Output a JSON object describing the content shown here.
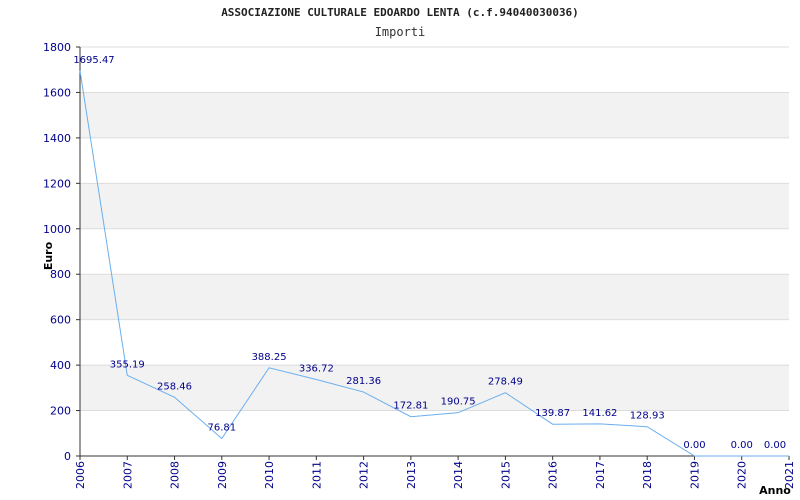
{
  "chart_data": {
    "type": "line",
    "title": "ASSOCIAZIONE CULTURALE EDOARDO LENTA (c.f.94040030036)",
    "subtitle": "Importi",
    "xlabel": "Anno",
    "ylabel": "Euro",
    "ylim": [
      0,
      1800
    ],
    "yticks": [
      "0",
      "200",
      "400",
      "600",
      "800",
      "1000",
      "1200",
      "1400",
      "1600",
      "1800"
    ],
    "x": [
      "2006",
      "2007",
      "2008",
      "2009",
      "2010",
      "2011",
      "2012",
      "2013",
      "2014",
      "2015",
      "2016",
      "2017",
      "2018",
      "2019",
      "2020",
      "2021"
    ],
    "values": [
      1695.47,
      355.19,
      258.46,
      76.81,
      388.25,
      336.72,
      281.36,
      172.81,
      190.75,
      278.49,
      139.87,
      141.62,
      128.93,
      0.0,
      0.0,
      0.0
    ],
    "labels": [
      "1695.47",
      "355.19",
      "258.46",
      "76.81",
      "388.25",
      "336.72",
      "281.36",
      "172.81",
      "190.75",
      "278.49",
      "139.87",
      "141.62",
      "128.93",
      "0.00",
      "0.00",
      "0.00"
    ],
    "grid": true,
    "colors": {
      "line": "#6aaeee",
      "text": "#00008b",
      "band": "#f2f2f2",
      "grid": "#dcdcdc"
    }
  }
}
